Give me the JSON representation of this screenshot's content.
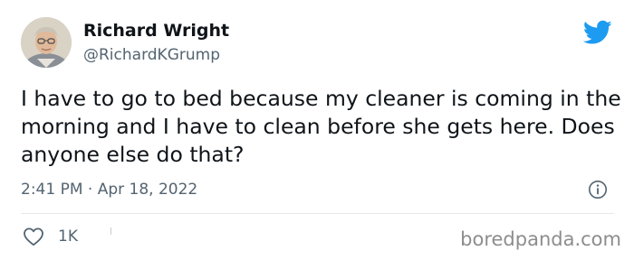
{
  "user": {
    "display_name": "Richard Wright",
    "handle": "@RichardKGrump"
  },
  "tweet": {
    "text": "I have to go to bed because my cleaner is coming in the morning and I have to clean before she gets here. Does anyone else do that?",
    "timestamp": "2:41 PM · Apr 18, 2022"
  },
  "actions": {
    "like_count": "1K"
  },
  "watermark": "boredpanda.com",
  "colors": {
    "twitter_blue": "#1d9bf0",
    "secondary_text": "#536471",
    "primary_text": "#0f1419"
  },
  "icons": {
    "brand": "twitter-bird-icon",
    "info": "info-icon",
    "like": "heart-icon"
  }
}
